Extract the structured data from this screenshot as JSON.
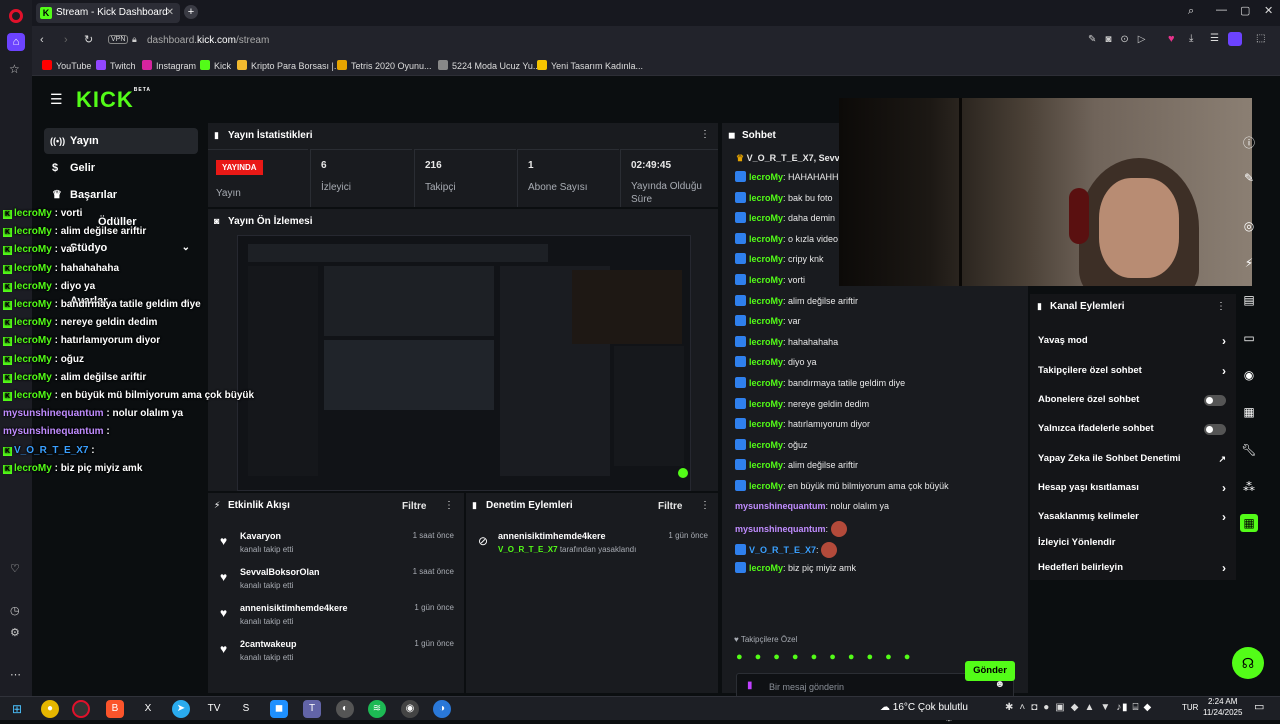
{
  "browser": {
    "tab_title": "Stream - Kick Dashboard",
    "url_prefix": "dashboard.",
    "url_domain": "kick.com",
    "url_path": "/stream",
    "vpn_label": "VPN",
    "bookmarks": [
      "YouTube",
      "Twitch",
      "Instagram",
      "Kick",
      "Kripto Para Borsası |...",
      "Tetris 2020 Oyunu...",
      "5224 Moda Ucuz Yu...",
      "Yeni Tasarım Kadınla..."
    ]
  },
  "logo": "KICK",
  "logo_sup": "BETA",
  "nav": {
    "items": [
      "Yayın",
      "Gelir",
      "Başarılar",
      "Ödüller",
      "Stüdyo",
      "Ayarlar"
    ]
  },
  "stats": {
    "title": "Yayın İstatistikleri",
    "live_badge": "YAYINDA",
    "live_label": "Yayın",
    "cells": [
      {
        "value": "6",
        "label": "İzleyici"
      },
      {
        "value": "216",
        "label": "Takipçi"
      },
      {
        "value": "1",
        "label": "Abone Sayısı"
      },
      {
        "value": "02:49:45",
        "label": "Yayında Olduğu Süre"
      }
    ]
  },
  "preview": {
    "title": "Yayın Ön İzlemesi"
  },
  "activity": {
    "title": "Etkinlik Akışı",
    "filter": "Filtre",
    "items": [
      {
        "name": "Kavaryon",
        "sub": "kanalı takip etti",
        "time": "1 saat önce"
      },
      {
        "name": "SevvalBoksorOlan",
        "sub": "kanalı takip etti",
        "time": "1 saat önce"
      },
      {
        "name": "annenisiktimhemde4kere",
        "sub": "kanalı takip etti",
        "time": "1 gün önce"
      },
      {
        "name": "2cantwakeup",
        "sub": "kanalı takip etti",
        "time": "1 gün önce"
      }
    ]
  },
  "moderation": {
    "title": "Denetim Eylemleri",
    "filter": "Filtre",
    "items": [
      {
        "name": "annenisiktimhemde4kere",
        "by": "V_O_R_T_E_X7",
        "sub": "tarafından yasaklandı",
        "time": "1 gün önce"
      }
    ]
  },
  "chat": {
    "title": "Sohbet",
    "pinned": "V_O_R_T_E_X7, SevvalB",
    "messages": [
      {
        "user": "lecroMy",
        "text": "HAHAHAHH"
      },
      {
        "user": "lecroMy",
        "text": "bak bu foto"
      },
      {
        "user": "lecroMy",
        "text": "daha demin"
      },
      {
        "user": "lecroMy",
        "text": "o kızla video"
      },
      {
        "user": "lecroMy",
        "text": "cripy knk"
      },
      {
        "user": "lecroMy",
        "text": "vorti"
      },
      {
        "user": "lecroMy",
        "text": "alim değilse ariftir"
      },
      {
        "user": "lecroMy",
        "text": "var"
      },
      {
        "user": "lecroMy",
        "text": "hahahahaha"
      },
      {
        "user": "lecroMy",
        "text": "diyo ya"
      },
      {
        "user": "lecroMy",
        "text": "bandırmaya tatile geldim diye"
      },
      {
        "user": "lecroMy",
        "text": "nereye geldin dedim"
      },
      {
        "user": "lecroMy",
        "text": "hatırlamıyorum diyor"
      },
      {
        "user": "lecroMy",
        "text": "oğuz"
      },
      {
        "user": "lecroMy",
        "text": "alim değilse ariftir"
      },
      {
        "user": "lecroMy",
        "text": "en büyük mü bilmiyorum ama çok büyük"
      },
      {
        "user": "mysunshinequantum",
        "text": "nolur olalım ya"
      },
      {
        "user": "mysunshinequantum",
        "text": ""
      },
      {
        "user": "V_O_R_T_E_X7",
        "text": ""
      },
      {
        "user": "lecroMy",
        "text": "biz piç miyiz amk"
      }
    ],
    "followers_only": "Takipçilere Özel",
    "input_placeholder": "Bir mesaj gönderin",
    "send": "Gönder"
  },
  "channel_actions": {
    "title": "Kanal Eylemleri",
    "items": [
      {
        "label": "Yavaş mod",
        "kind": "chev"
      },
      {
        "label": "Takipçilere özel sohbet",
        "kind": "chev"
      },
      {
        "label": "Abonelere özel sohbet",
        "kind": "toggle"
      },
      {
        "label": "Yalnızca ifadelerle sohbet",
        "kind": "toggle"
      },
      {
        "label": "Yapay Zeka ile Sohbet Denetimi",
        "kind": "ext"
      },
      {
        "label": "Hesap yaşı kısıtlaması",
        "kind": "chev"
      },
      {
        "label": "Yasaklanmış kelimeler",
        "kind": "chev"
      },
      {
        "label": "İzleyici Yönlendir",
        "kind": "none"
      },
      {
        "label": "Hedefleri belirleyin",
        "kind": "chev"
      }
    ]
  },
  "overlay": {
    "lines": [
      {
        "user": "lecroMy",
        "text": "vorti"
      },
      {
        "user": "lecroMy",
        "text": "alim değilse ariftir"
      },
      {
        "user": "lecroMy",
        "text": "var"
      },
      {
        "user": "lecroMy",
        "text": "hahahahaha"
      },
      {
        "user": "lecroMy",
        "text": "diyo ya"
      },
      {
        "user": "lecroMy",
        "text": "bandırmaya tatile geldim diye"
      },
      {
        "user": "lecroMy",
        "text": "nereye geldin dedim"
      },
      {
        "user": "lecroMy",
        "text": "hatırlamıyorum diyor"
      },
      {
        "user": "lecroMy",
        "text": "oğuz"
      },
      {
        "user": "lecroMy",
        "text": "alim değilse ariftir"
      },
      {
        "user": "lecroMy",
        "text": "en büyük mü bilmiyorum ama çok büyük"
      },
      {
        "user": "mysunshinequantum",
        "text": "nolur olalım ya"
      },
      {
        "user": "mysunshinequantum",
        "text": ""
      },
      {
        "user": "V_O_R_T_E_X7",
        "text": ""
      },
      {
        "user": "lecroMy",
        "text": "biz piç miyiz amk"
      }
    ]
  },
  "taskbar": {
    "weather": "16°C  Çok bulutlu",
    "lang": "TUR",
    "time": "2:24 AM",
    "date": "11/24/2025"
  },
  "colors": {
    "accent": "#53fc18",
    "panel": "#191b1f",
    "bg": "#0b0e10"
  }
}
